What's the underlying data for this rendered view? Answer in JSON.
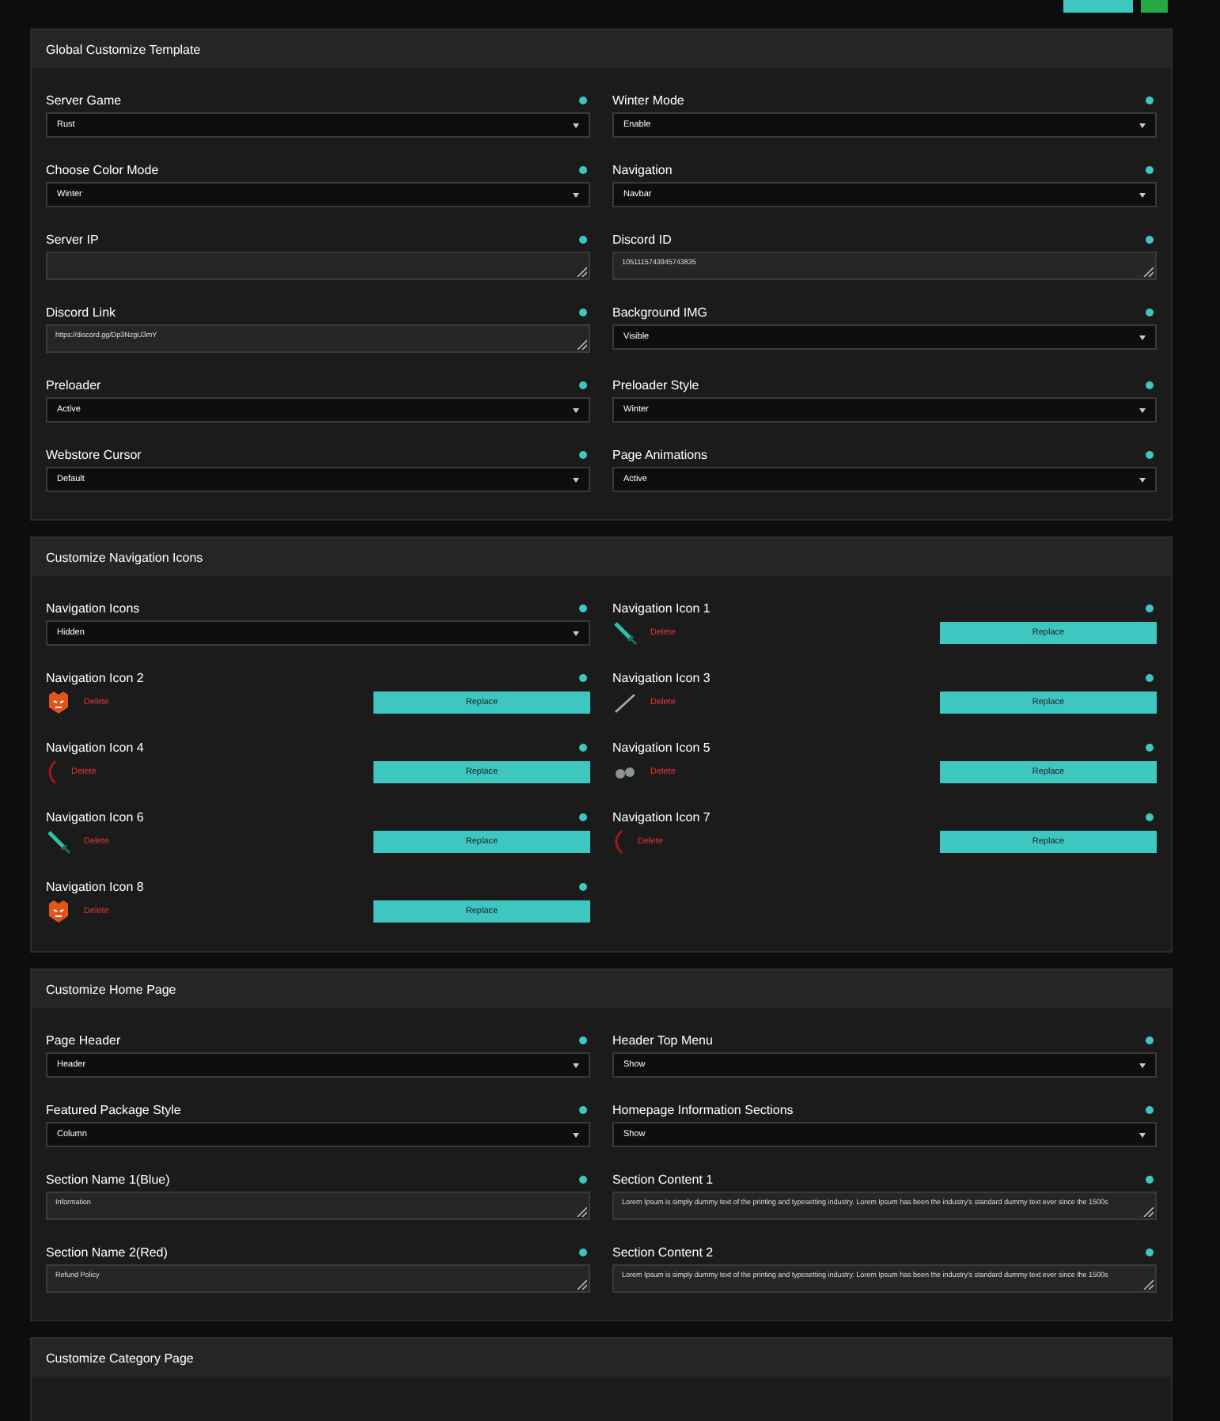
{
  "top_actions": [
    {
      "kind": "teal"
    },
    {
      "kind": "green"
    }
  ],
  "sections": [
    {
      "title": "Global Customize Template",
      "kind": "fields",
      "fields": [
        {
          "label": "Server Game",
          "kind": "select",
          "value": "Rust"
        },
        {
          "label": "Winter Mode",
          "kind": "select",
          "value": "Enable"
        },
        {
          "label": "Choose Color Mode",
          "kind": "select",
          "value": "Winter"
        },
        {
          "label": "Navigation",
          "kind": "select",
          "value": "Navbar"
        },
        {
          "label": "Server IP",
          "kind": "text"
        },
        {
          "label": "Discord ID",
          "kind": "text",
          "value": "1051115743945743835"
        },
        {
          "label": "Discord Link",
          "kind": "text",
          "value": "https://discord.gg/Dp3NzgU3mY"
        },
        {
          "label": "Background IMG",
          "kind": "select",
          "value": "Visible"
        },
        {
          "label": "Preloader",
          "kind": "select",
          "value": "Active"
        },
        {
          "label": "Preloader Style",
          "kind": "select",
          "value": "Winter"
        },
        {
          "label": "Webstore Cursor",
          "kind": "select",
          "value": "Default"
        },
        {
          "label": "Page Animations",
          "kind": "select",
          "value": "Active"
        }
      ]
    },
    {
      "title": "Customize Navigation Icons",
      "kind": "fields",
      "fields": [
        {
          "label": "Navigation Icons",
          "kind": "select",
          "value": "Hidden"
        },
        {
          "label": "Navigation Icon 1",
          "kind": "icon",
          "delete": "Delete",
          "replace": "Replace"
        },
        {
          "label": "Navigation Icon 2",
          "kind": "icon",
          "delete": "Delete",
          "replace": "Replace"
        },
        {
          "label": "Navigation Icon 3",
          "kind": "icon",
          "delete": "Delete",
          "replace": "Replace"
        },
        {
          "label": "Navigation Icon 4",
          "kind": "icon",
          "delete": "Delete",
          "replace": "Replace"
        },
        {
          "label": "Navigation Icon 5",
          "kind": "icon",
          "delete": "Delete",
          "replace": "Replace"
        },
        {
          "label": "Navigation Icon 6",
          "kind": "icon",
          "delete": "Delete",
          "replace": "Replace"
        },
        {
          "label": "Navigation Icon 7",
          "kind": "icon",
          "delete": "Delete",
          "replace": "Replace"
        },
        {
          "label": "Navigation Icon 8",
          "kind": "icon",
          "delete": "Delete",
          "replace": "Replace"
        }
      ]
    },
    {
      "title": "Customize Home Page",
      "kind": "fields",
      "fields": [
        {
          "label": "Page Header",
          "kind": "select",
          "value": "Header"
        },
        {
          "label": "Header Top Menu",
          "kind": "select",
          "value": "Show"
        },
        {
          "label": "Featured Package Style",
          "kind": "select",
          "value": "Column"
        },
        {
          "label": "Homepage Information Sections",
          "kind": "select",
          "value": "Show"
        },
        {
          "label": "Section Name 1(Blue)",
          "kind": "text",
          "value": "Information"
        },
        {
          "label": "Section Content 1",
          "kind": "text",
          "value": "Lorem Ipsum is simply dummy text of the printing and typesetting industry. Lorem Ipsum has been the industry's standard dummy text ever since the 1500s"
        },
        {
          "label": "Section Name 2(Red)",
          "kind": "text",
          "value": "Refund Policy"
        },
        {
          "label": "Section Content 2",
          "kind": "text",
          "value": "Lorem Ipsum is simply dummy text of the printing and typesetting industry. Lorem Ipsum has been the industry's standard dummy text ever since the 1500s"
        }
      ]
    },
    {
      "title": "Customize Category Page",
      "kind": "fields"
    }
  ]
}
